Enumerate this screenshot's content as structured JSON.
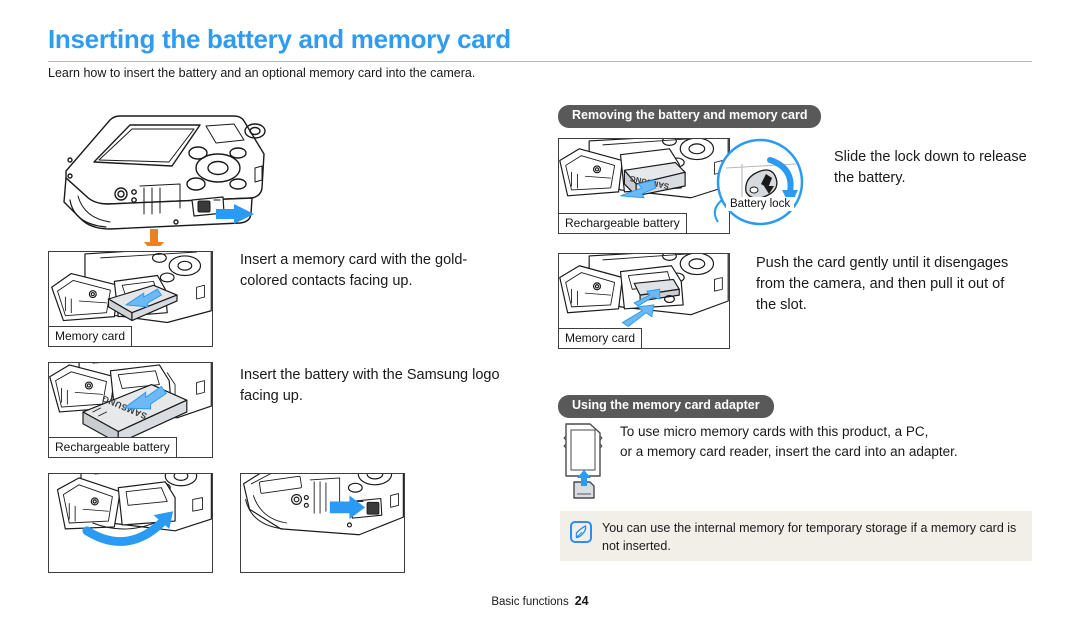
{
  "header": {
    "title": "Inserting the battery and memory card",
    "subtitle": "Learn how to insert the battery and an optional memory card into the camera."
  },
  "left_column": {
    "figures": [
      {
        "name": "camera-bottom-latch",
        "caption": "",
        "icon": "camera-body-with-latch-arrow"
      },
      {
        "name": "memory-card-insert",
        "caption": "Memory card",
        "icon": "camera-slot-memory-card-insert"
      },
      {
        "name": "battery-insert",
        "caption": "Rechargeable battery",
        "icon": "camera-slot-battery-insert"
      },
      {
        "name": "cover-close",
        "caption": "",
        "icon": "camera-cover-rotate-close"
      },
      {
        "name": "latch-lock",
        "caption": "",
        "icon": "camera-latch-slide-lock"
      }
    ],
    "texts": [
      "Insert a memory card with the gold-colored contacts facing up.",
      "Insert the battery with the Samsung logo facing up."
    ]
  },
  "right_column": {
    "section_removing": {
      "pill_label": "Removing the battery and memory card",
      "figures": [
        {
          "name": "battery-remove",
          "caption": "Rechargeable battery",
          "callout": "Battery lock",
          "icon": "camera-slot-battery-remove"
        },
        {
          "name": "memory-card-remove",
          "caption": "Memory card",
          "icon": "camera-slot-memory-card-remove"
        }
      ],
      "texts": [
        "Slide the lock down to release the battery.",
        "Push the card gently until it disengages from the camera, and then pull it out of the slot."
      ]
    },
    "section_adapter": {
      "pill_label": "Using the memory card adapter",
      "icon": "sd-card-adapter-icon",
      "text_lines": [
        "To use micro memory cards with this product, a PC,",
        "or a memory card reader, insert the card into an adapter."
      ]
    },
    "note": {
      "icon": "note-pen-icon",
      "text": "You can use the internal memory for temporary storage if a memory card is not inserted."
    }
  },
  "footer": {
    "section": "Basic functions",
    "page_number": "24"
  },
  "colors": {
    "title_blue": "#2f9cf0",
    "pill_gray": "#595959",
    "note_bg": "#f2efe9",
    "arrow_blue": "#2b9af3",
    "arrow_orange": "#e8831e"
  }
}
